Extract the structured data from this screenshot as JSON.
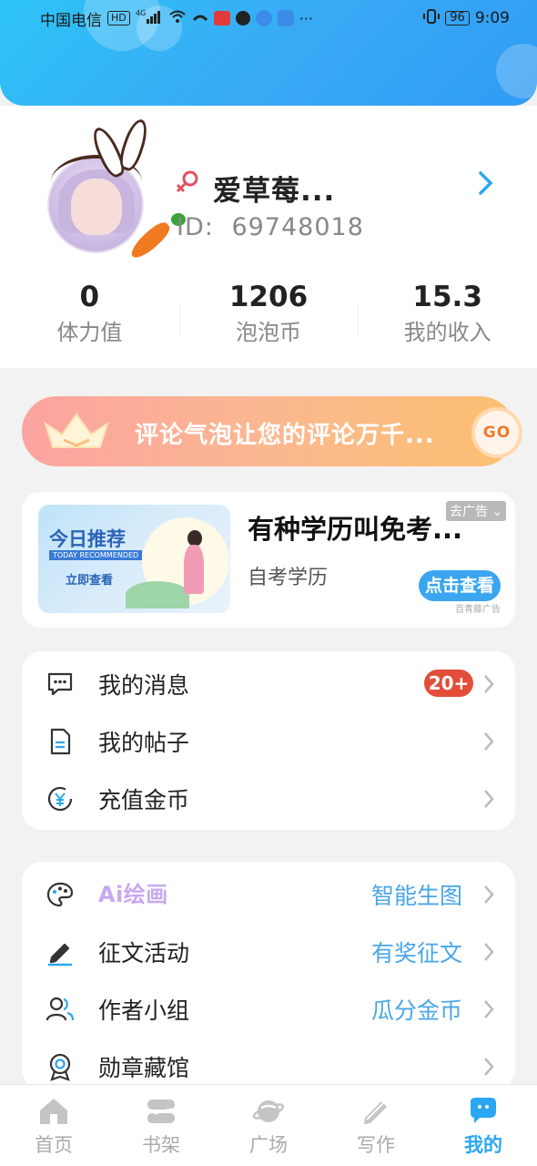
{
  "status_bar": {
    "carrier": "中国电信",
    "hd": "HD",
    "network": "4G",
    "battery": "96",
    "time": "9:09"
  },
  "profile": {
    "username": "爱草莓...",
    "id_label": "ID:",
    "id_value": "69748018"
  },
  "stats": [
    {
      "value": "0",
      "label": "体力值"
    },
    {
      "value": "1206",
      "label": "泡泡币"
    },
    {
      "value": "15.3",
      "label": "我的收入"
    }
  ],
  "promo": {
    "text": "评论气泡让您的评论万千...",
    "go": "GO"
  },
  "ad": {
    "image_title": "今日推荐",
    "image_subtitle": "TODAY RECOMMENDED",
    "image_button": "立即查看",
    "title": "有种学历叫免考...",
    "subtitle": "自考学历",
    "remove": "去广告",
    "cta": "点击查看",
    "source": "百青藤广告"
  },
  "menu_one": [
    {
      "label": "我的消息",
      "badge": "20+",
      "icon": "message-icon"
    },
    {
      "label": "我的帖子",
      "icon": "document-icon"
    },
    {
      "label": "充值金币",
      "icon": "yen-coin-icon"
    }
  ],
  "menu_two": [
    {
      "label": "Ai绘画",
      "extra": "智能生图",
      "icon": "palette-icon"
    },
    {
      "label": "征文活动",
      "extra": "有奖征文",
      "icon": "pen-icon"
    },
    {
      "label": "作者小组",
      "extra": "瓜分金币",
      "icon": "group-icon"
    },
    {
      "label": "勋章藏馆",
      "icon": "medal-icon"
    }
  ],
  "bottom_nav": [
    {
      "label": "首页",
      "icon": "home-icon"
    },
    {
      "label": "书架",
      "icon": "bookshelf-icon"
    },
    {
      "label": "广场",
      "icon": "planet-icon"
    },
    {
      "label": "写作",
      "icon": "write-icon"
    },
    {
      "label": "我的",
      "icon": "profile-chat-icon",
      "active": true
    }
  ],
  "colors": {
    "accent": "#2ba6f2",
    "badge": "#e24e3a",
    "promo_start": "#fba3a0",
    "promo_end": "#fcc070"
  }
}
